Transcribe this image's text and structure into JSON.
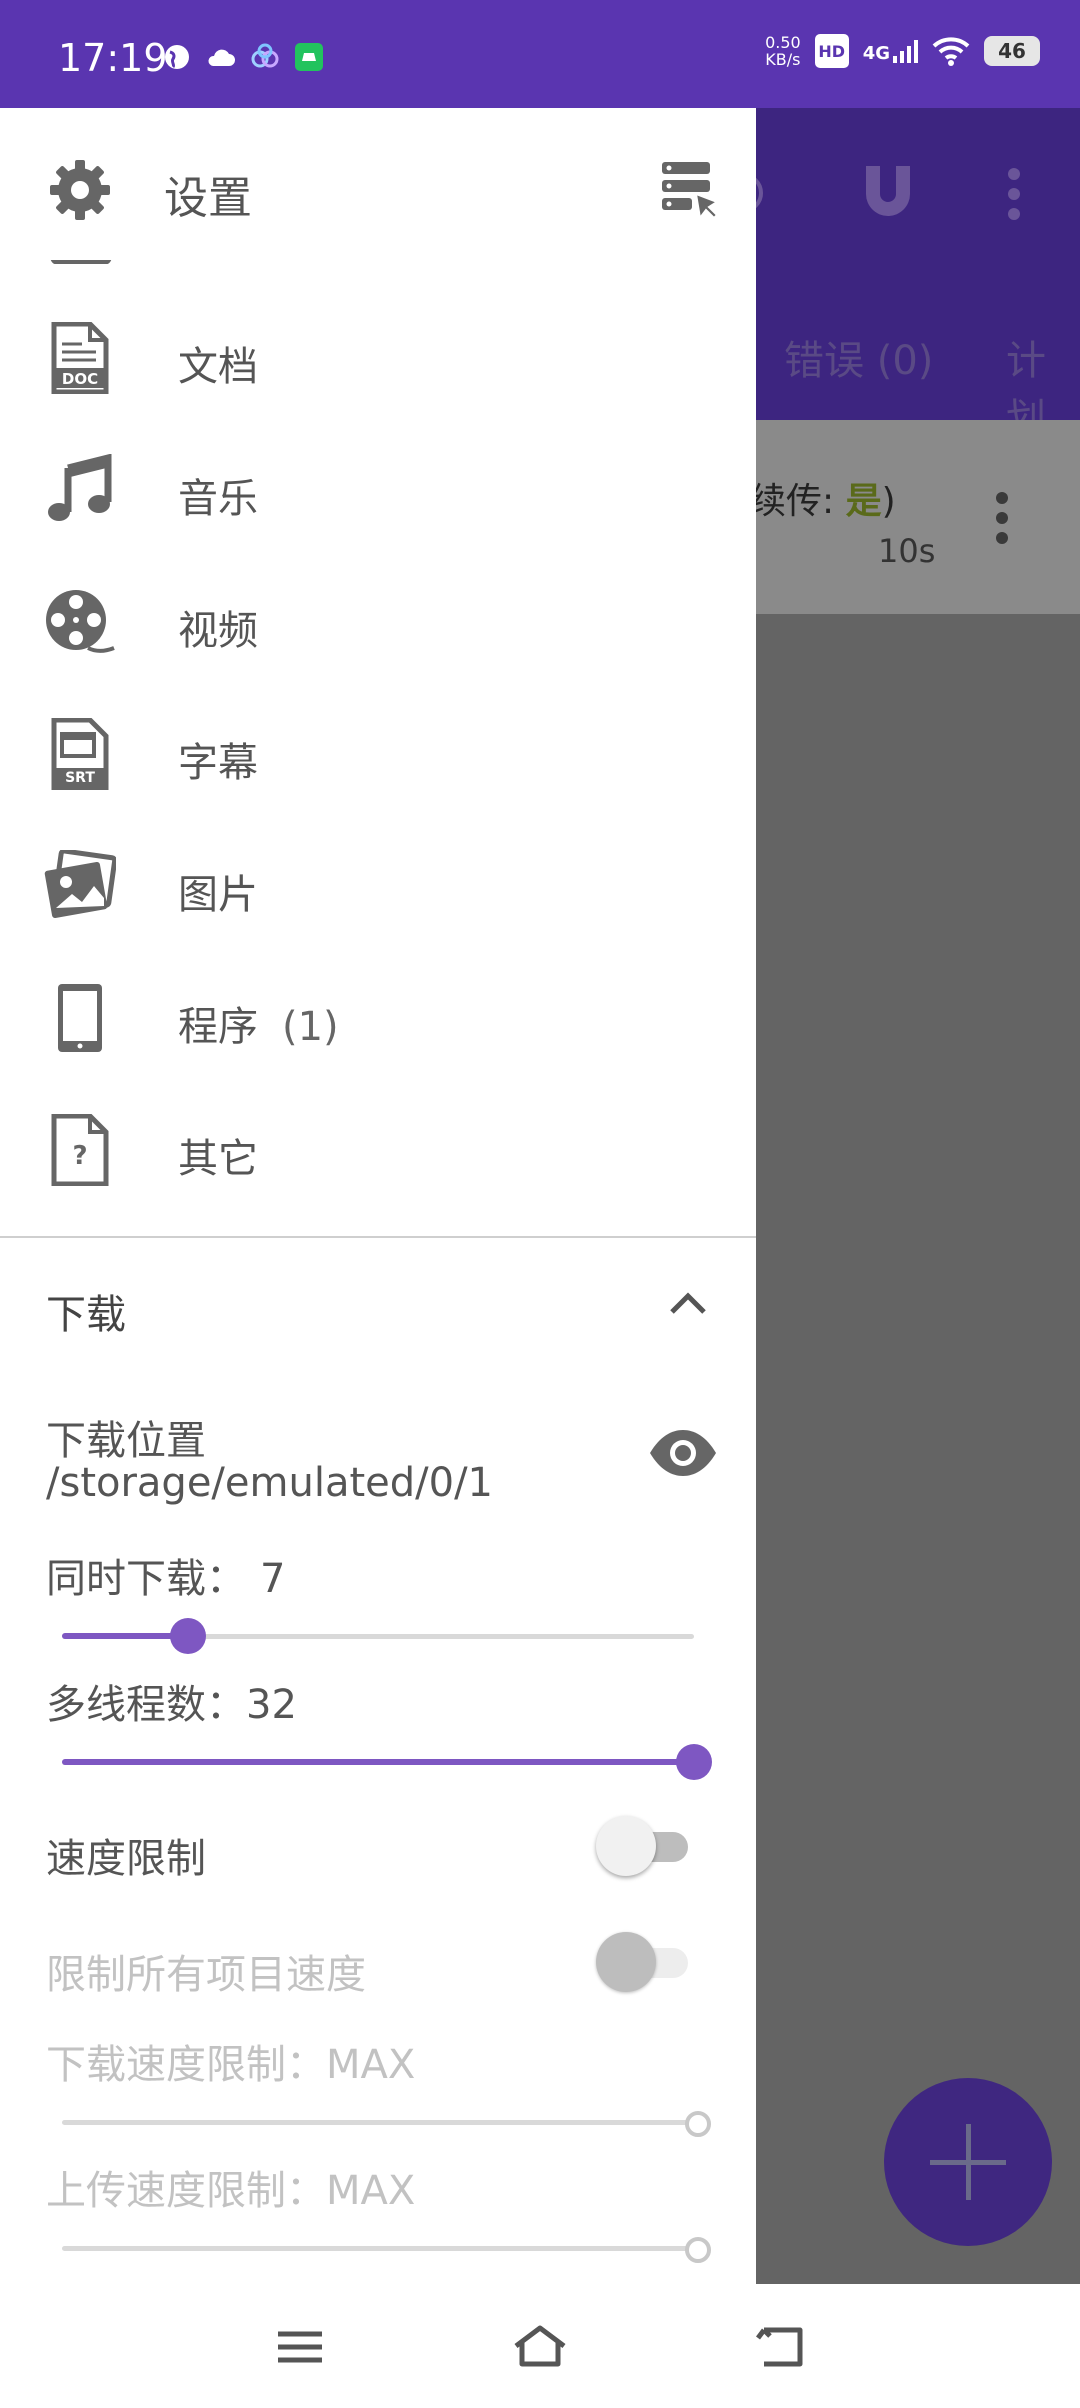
{
  "status_bar": {
    "time": "17:19",
    "net_speed_value": "0.50",
    "net_speed_unit": "KB/s",
    "hd": "HD",
    "network": "4G",
    "battery": "46"
  },
  "background_app": {
    "tab_error": "错误 (0)",
    "tab_schedule": "计划",
    "row_resume_label": "续传:",
    "row_resume_value": "是",
    "row_resume_close": ")",
    "row_time": "10s"
  },
  "drawer": {
    "title": "设置",
    "items": [
      {
        "label": "文档",
        "count": ""
      },
      {
        "label": "音乐",
        "count": ""
      },
      {
        "label": "视频",
        "count": ""
      },
      {
        "label": "字幕",
        "count": ""
      },
      {
        "label": "图片",
        "count": ""
      },
      {
        "label": "程序",
        "count": "(1)"
      },
      {
        "label": "其它",
        "count": ""
      }
    ],
    "download_section": {
      "title": "下载",
      "location_label": "下载位置",
      "location_path": "/storage/emulated/0/1",
      "concurrent_label": "同时下载：",
      "concurrent_value": "7",
      "concurrent_fraction": 0.2,
      "threads_label": "多线程数：",
      "threads_value": "32",
      "threads_fraction": 1.0,
      "speed_limit_label": "速度限制",
      "speed_limit_on": false,
      "limit_all_label": "限制所有项目速度",
      "limit_all_on": false,
      "download_limit_label": "下载速度限制：",
      "download_limit_value": "MAX",
      "upload_limit_label": "上传速度限制：",
      "upload_limit_value": "MAX"
    }
  },
  "colors": {
    "accent": "#7e57c2",
    "status_bar": "#5a35b0",
    "app_header": "#3d2580"
  }
}
